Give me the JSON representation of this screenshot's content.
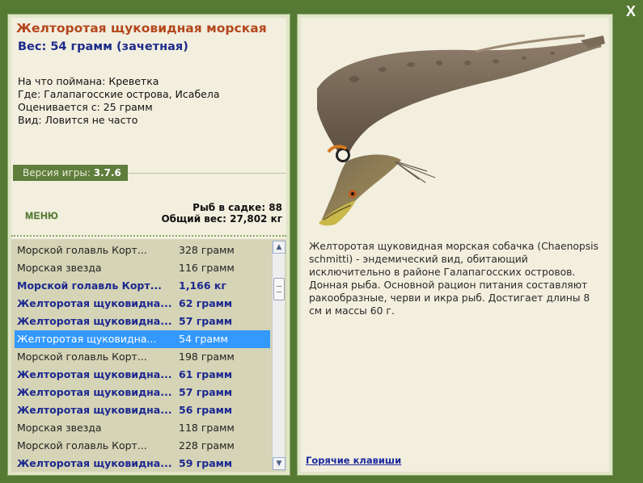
{
  "window": {
    "close_label": "X"
  },
  "fish": {
    "title": "Желторотая щуковидная морская",
    "weight": "Вес: 54 грамм (зачетная)",
    "info": [
      "На что поймана: Креветка",
      "Где: Галапагосские острова, Исабела",
      "Оценивается с: 25 грамм",
      "Вид: Ловится не часто"
    ],
    "description": "Желторотая щуковидная морская собачка (Chaenopsis schmitti) - эндемический вид, обитающий исключительно в районе Галапагосских островов. Донная рыба. Основной рацион питания составляют ракообразные, черви и икра рыб. Достигает длины 8 см и массы 60 г."
  },
  "version": {
    "label": "Версия игры:",
    "value": "3.7.6"
  },
  "menu_label": "МЕНЮ",
  "stats": {
    "fish_count": "Рыб в садке: 88",
    "total_weight": "Общий вес: 27,802 кг"
  },
  "catch_list": [
    {
      "name": "Морской голавль Корт...",
      "weight": "328 грамм",
      "style": "normal"
    },
    {
      "name": "Морская звезда",
      "weight": "116 грамм",
      "style": "normal"
    },
    {
      "name": "Морской голавль Корт...",
      "weight": "1,166 кг",
      "style": "bold"
    },
    {
      "name": "Желторотая щуковидна...",
      "weight": "62 грамм",
      "style": "bold"
    },
    {
      "name": "Желторотая щуковидна...",
      "weight": "57 грамм",
      "style": "bold"
    },
    {
      "name": "Желторотая щуковидна...",
      "weight": "54 грамм",
      "style": "selected"
    },
    {
      "name": "Морской голавль Корт...",
      "weight": "198 грамм",
      "style": "normal"
    },
    {
      "name": "Желторотая щуковидна...",
      "weight": "61 грамм",
      "style": "bold"
    },
    {
      "name": "Желторотая щуковидна...",
      "weight": "57 грамм",
      "style": "bold"
    },
    {
      "name": "Желторотая щуковидна...",
      "weight": "56 грамм",
      "style": "bold"
    },
    {
      "name": "Морская звезда",
      "weight": "118 грамм",
      "style": "normal"
    },
    {
      "name": "Морской голавль Корт...",
      "weight": "228 грамм",
      "style": "normal"
    },
    {
      "name": "Желторотая щуковидна...",
      "weight": "59 грамм",
      "style": "bold"
    }
  ],
  "hotkeys_label": "Горячие клавиши",
  "colors": {
    "background": "#567a34",
    "panel": "#f3efdf",
    "title": "#b3471c",
    "bold_row": "#1c2890",
    "selected_row": "#3399ff"
  }
}
